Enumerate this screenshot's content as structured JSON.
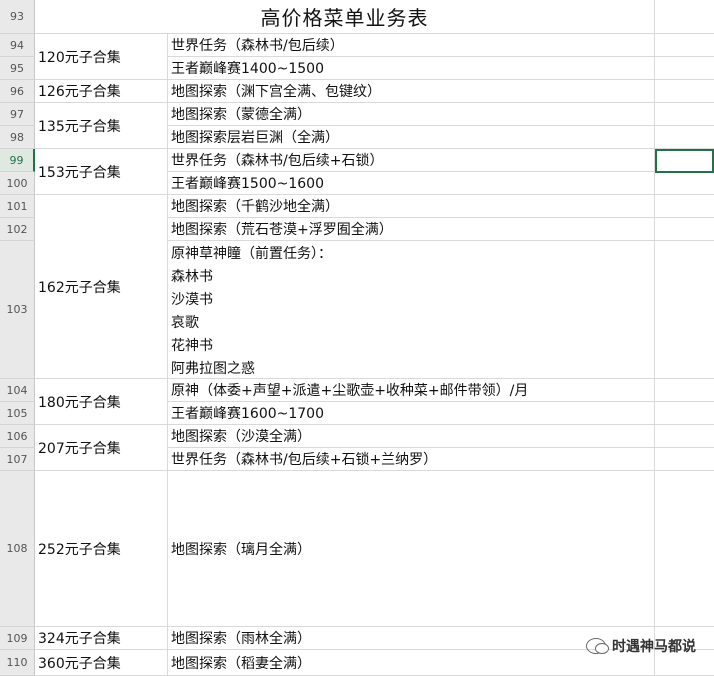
{
  "title": "高价格菜单业务表",
  "rows": [
    {
      "num": "93"
    },
    {
      "num": "94"
    },
    {
      "num": "95"
    },
    {
      "num": "96"
    },
    {
      "num": "97"
    },
    {
      "num": "98"
    },
    {
      "num": "99"
    },
    {
      "num": "100"
    },
    {
      "num": "101"
    },
    {
      "num": "102"
    },
    {
      "num": "103"
    },
    {
      "num": "104"
    },
    {
      "num": "105"
    },
    {
      "num": "106"
    },
    {
      "num": "107"
    },
    {
      "num": "108"
    },
    {
      "num": "109"
    },
    {
      "num": "110"
    }
  ],
  "groups": [
    {
      "price": "120元子合集",
      "items": [
        "世界任务（森林书/包后续）",
        "王者巅峰赛1400~1500"
      ]
    },
    {
      "price": "126元子合集",
      "items": [
        "地图探索（渊下宫全满、包键纹）"
      ]
    },
    {
      "price": "135元子合集",
      "items": [
        "地图探索（蒙德全满）",
        "地图探索层岩巨渊（全满）"
      ]
    },
    {
      "price": "153元子合集",
      "items": [
        "世界任务（森林书/包后续+石锁）",
        "王者巅峰赛1500~1600"
      ]
    },
    {
      "price": "162元子合集",
      "items": [
        "地图探索（千鹤沙地全满）",
        "地图探索（荒石苍漠+浮罗囿全满）"
      ],
      "multi": [
        "原神草神瞳（前置任务）：",
        "森林书",
        "沙漠书",
        "哀歌",
        "花神书",
        "阿弗拉图之惑"
      ]
    },
    {
      "price": "180元子合集",
      "items": [
        "原神（体委+声望+派遣+尘歌壶+收种菜+邮件带领）/月",
        "王者巅峰赛1600~1700"
      ]
    },
    {
      "price": "207元子合集",
      "items": [
        "地图探索（沙漠全满）",
        "世界任务（森林书/包后续+石锁+兰纳罗）"
      ]
    },
    {
      "price": "252元子合集",
      "items": [
        "地图探索（璃月全满）"
      ]
    },
    {
      "price": "324元子合集",
      "items": [
        "地图探索（雨林全满）"
      ]
    },
    {
      "price": "360元子合集",
      "items": [
        "地图探索（稻妻全满）"
      ]
    }
  ],
  "watermark": "时遇神马都说",
  "colors": {
    "accent": "#217346",
    "grid": "#d9d9d9",
    "header_bg": "#e9e9e9"
  }
}
